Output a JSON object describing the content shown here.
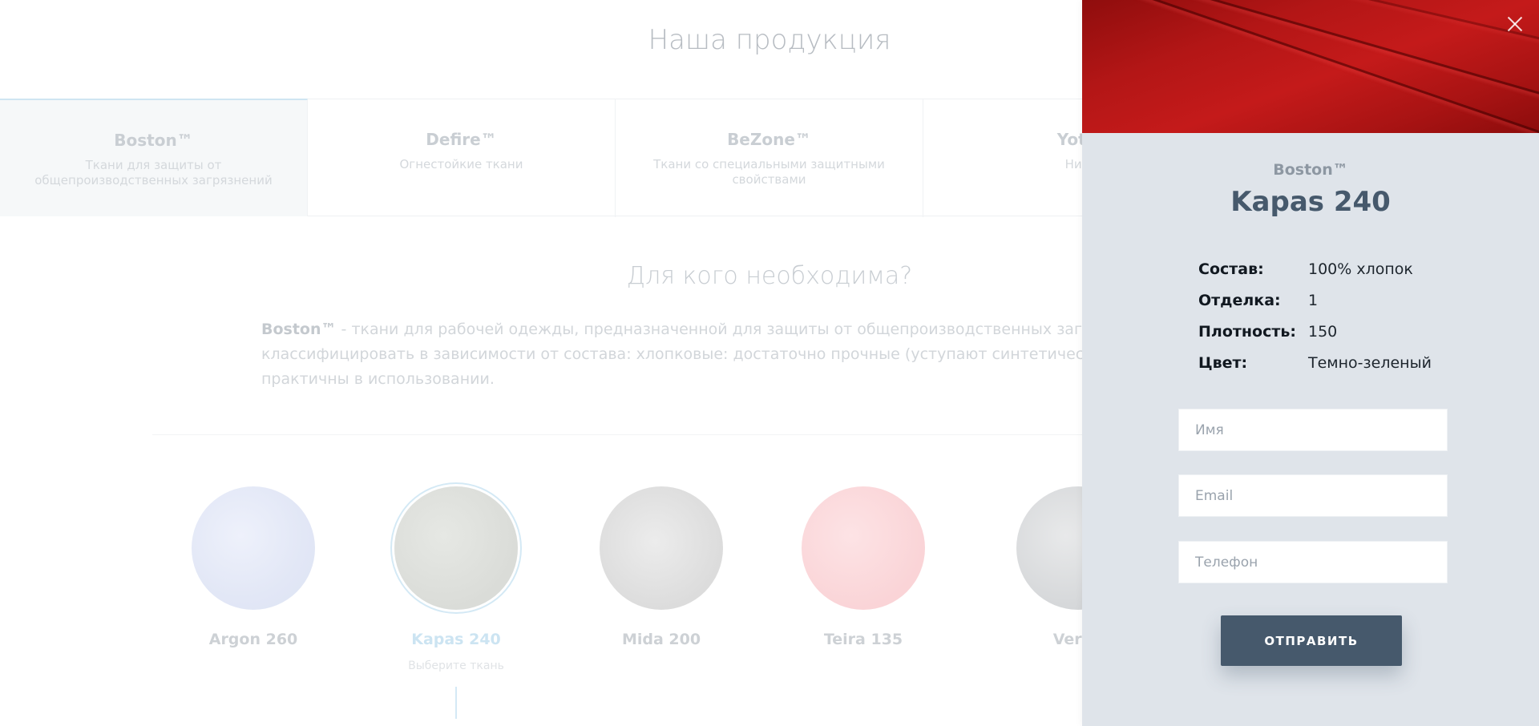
{
  "page": {
    "title": "Наша продукция",
    "tabs": [
      {
        "name": "Boston™",
        "desc": "Ткани для защиты от общепроизводственных загрязнений"
      },
      {
        "name": "Defire™",
        "desc": "Огнестойкие ткани"
      },
      {
        "name": "BeZone™",
        "desc": "Ткани со специальными защитными свойствами"
      },
      {
        "name": "Yote",
        "desc": "Нит"
      }
    ],
    "section_title": "Для кого необходима?",
    "lead_brand": "Boston™",
    "lead_line1": " - ткани для рабочей одежды, предназначенной для защиты от общепроизводственных загрязнений",
    "lead_line2": "классифицировать в зависимости от состава: хлопковые: достаточно прочные (уступают синтетическим и см",
    "lead_line3": "практичны в использовании.",
    "swatches": [
      {
        "label": "Argon 260"
      },
      {
        "label": "Kapas 240",
        "hint": "Выберите ткань"
      },
      {
        "label": "Mida 200"
      },
      {
        "label": "Teira 135"
      },
      {
        "label": "Veron"
      }
    ]
  },
  "drawer": {
    "brand": "Boston™",
    "title": "Kapas 240",
    "specs": [
      {
        "key": "Состав:",
        "value": "100% хлопок"
      },
      {
        "key": "Отделка:",
        "value": "1"
      },
      {
        "key": "Плотность:",
        "value": "150"
      },
      {
        "key": "Цвет:",
        "value": "Темно-зеленый"
      }
    ],
    "form": {
      "name_placeholder": "Имя",
      "email_placeholder": "Email",
      "phone_placeholder": "Телефон",
      "submit_label": "ОТПРАВИТЬ"
    }
  },
  "colors": {
    "accent": "#46596c",
    "drawer_bg": "#dfe4ea",
    "fabric": "#b31616"
  }
}
